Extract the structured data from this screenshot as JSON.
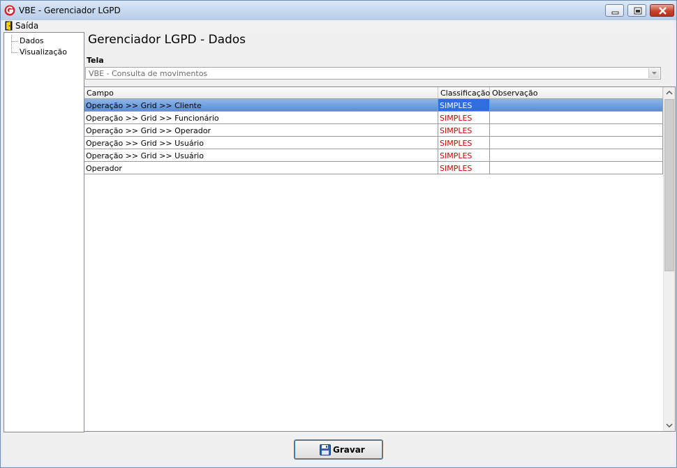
{
  "window": {
    "title": "VBE - Gerenciador LGPD"
  },
  "menu": {
    "items": [
      {
        "label": "Saída",
        "icon": "exit-door-icon"
      }
    ]
  },
  "tree": {
    "items": [
      {
        "label": "Dados"
      },
      {
        "label": "Visualização"
      }
    ]
  },
  "main": {
    "heading": "Gerenciador LGPD - Dados",
    "tela_label": "Tela",
    "tela_value": "VBE - Consulta de movimentos"
  },
  "grid": {
    "columns": [
      "Campo",
      "Classificação",
      "Observação"
    ],
    "rows": [
      {
        "campo": "Operação >> Grid >> Cliente",
        "classificacao": "SIMPLES",
        "observacao": ""
      },
      {
        "campo": "Operação >> Grid >> Funcionário",
        "classificacao": "SIMPLES",
        "observacao": ""
      },
      {
        "campo": "Operação >> Grid >> Operador",
        "classificacao": "SIMPLES",
        "observacao": ""
      },
      {
        "campo": "Operação >> Grid >> Usuário",
        "classificacao": "SIMPLES",
        "observacao": ""
      },
      {
        "campo": "Operação >> Grid >> Usuário",
        "classificacao": "SIMPLES",
        "observacao": ""
      },
      {
        "campo": "Operador",
        "classificacao": "SIMPLES",
        "observacao": ""
      }
    ],
    "selected_row": 0
  },
  "footer": {
    "save_label": "Gravar",
    "save_icon": "floppy-disk-icon"
  },
  "colors": {
    "accent": "#2f6ee0",
    "classification_text": "#cc0000",
    "title_bar": "#c6d8ee"
  }
}
